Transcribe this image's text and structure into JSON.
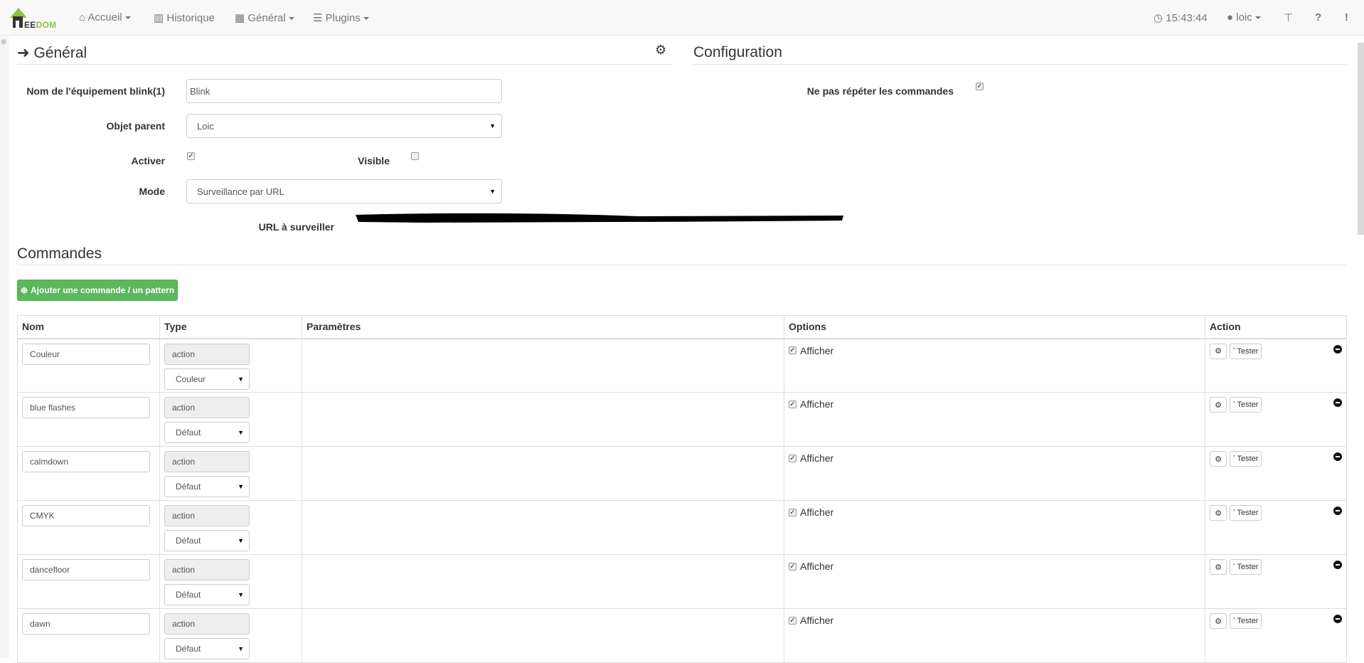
{
  "nav": {
    "brand": "EEDOM",
    "items": [
      {
        "label": "Accueil",
        "icon": "home-icon"
      },
      {
        "label": "Historique",
        "icon": "bar-chart-icon"
      },
      {
        "label": "Général",
        "icon": "qrcode-icon"
      },
      {
        "label": "Plugins",
        "icon": "tasks-icon"
      }
    ],
    "time": "15:43:44",
    "user": "loic"
  },
  "general": {
    "title": "Général",
    "config_title": "Configuration",
    "name_label": "Nom de l'équipement blink(1)",
    "name_value": "Blink",
    "parent_label": "Objet parent",
    "parent_value": "Loic",
    "activer_label": "Activer",
    "activer_checked": true,
    "visible_label": "Visible",
    "visible_checked": false,
    "mode_label": "Mode",
    "mode_value": "Surveillance par URL",
    "url_label": "URL à surveiller",
    "no_repeat_label": "Ne pas répéter les commandes",
    "no_repeat_checked": true
  },
  "commands": {
    "title": "Commandes",
    "add_button": "Ajouter une commande / un pattern",
    "columns": [
      "Nom",
      "Type",
      "Paramètres",
      "Options",
      "Action"
    ],
    "rows": [
      {
        "name": "Couleur",
        "type": "action",
        "subtype": "Couleur",
        "option": "Afficher",
        "test": "Tester"
      },
      {
        "name": "blue flashes",
        "type": "action",
        "subtype": "Défaut",
        "option": "Afficher",
        "test": "Tester"
      },
      {
        "name": "calmdown",
        "type": "action",
        "subtype": "Défaut",
        "option": "Afficher",
        "test": "Tester"
      },
      {
        "name": "CMYK",
        "type": "action",
        "subtype": "Défaut",
        "option": "Afficher",
        "test": "Tester"
      },
      {
        "name": "dancefloor",
        "type": "action",
        "subtype": "Défaut",
        "option": "Afficher",
        "test": "Tester"
      },
      {
        "name": "dawn",
        "type": "action",
        "subtype": "Défaut",
        "option": "Afficher",
        "test": "Tester"
      }
    ]
  },
  "colors": {
    "brand_green": "#8cc63f",
    "button_green": "#5cb85c"
  }
}
